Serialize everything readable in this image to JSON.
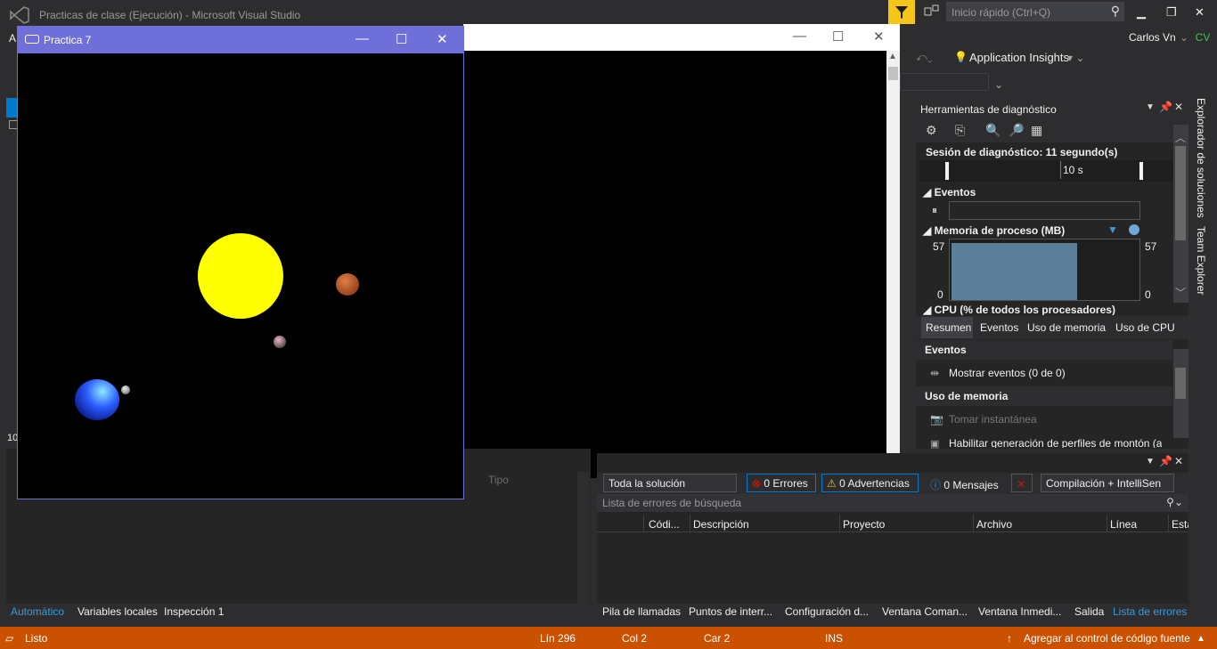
{
  "vs": {
    "title": "Practicas de clase (Ejecución) - Microsoft Visual Studio",
    "quick_launch_placeholder": "Inicio rápido (Ctrl+Q)",
    "user_name": "Carlos Vn",
    "user_initials": "CV",
    "application_insights": "Application Insights"
  },
  "gl_window": {
    "title": "Practica 7",
    "minimize": "—",
    "maximize": "☐",
    "close": "✕"
  },
  "console_window": {
    "minimize": "—",
    "maximize": "☐",
    "close": "✕"
  },
  "diagnostics": {
    "header": "Herramientas de diagnóstico",
    "session": "Sesión de diagnóstico: 11 segundo(s)",
    "timeline_label": "10 s",
    "events_label": "Eventos",
    "memory_label": "Memoria de proceso (MB)",
    "memory_max_left": "57",
    "memory_min_left": "0",
    "memory_max_right": "57",
    "memory_min_right": "0",
    "cpu_label": "CPU (% de todos los procesadores)",
    "tabs": [
      "Resumen",
      "Eventos",
      "Uso de memoria",
      "Uso de CPU"
    ],
    "events_section": "Eventos",
    "show_events": "Mostrar eventos (0 de 0)",
    "memory_section": "Uso de memoria",
    "snapshot": "Tomar instantánea",
    "heap_profiling": "Habilitar generación de perfiles de montón (a"
  },
  "side_tabs": [
    "Explorador de soluciones",
    "Team Explorer"
  ],
  "errors": {
    "scope": "Toda la solución",
    "errors_count": "0 Errores",
    "warnings_count": "0 Advertencias",
    "messages_count": "0 Mensajes",
    "build_filter": "Compilación + IntelliSen",
    "search_placeholder": "Lista de errores de búsqueda",
    "columns": [
      "Códi...",
      "Descripción",
      "Proyecto",
      "Archivo",
      "Línea",
      "Esta"
    ]
  },
  "autos": {
    "partial_label": "Tipo",
    "left_number": "10",
    "left_letter": "A"
  },
  "bottom_left_tabs": [
    "Automático",
    "Variables locales",
    "Inspección 1"
  ],
  "bottom_right_tabs": [
    "Pila de llamadas",
    "Puntos de interr...",
    "Configuración d...",
    "Ventana Coman...",
    "Ventana Inmedi...",
    "Salida",
    "Lista de errores"
  ],
  "status": {
    "ready": "Listo",
    "line": "Lín 296",
    "col": "Col 2",
    "car": "Car 2",
    "ins": "INS",
    "source_control": "Agregar al control de código fuente"
  },
  "colors": {
    "accent": "#007acc",
    "status": "#ca5100",
    "gl_title": "#6f6fd9",
    "sun": "#ffff00"
  }
}
